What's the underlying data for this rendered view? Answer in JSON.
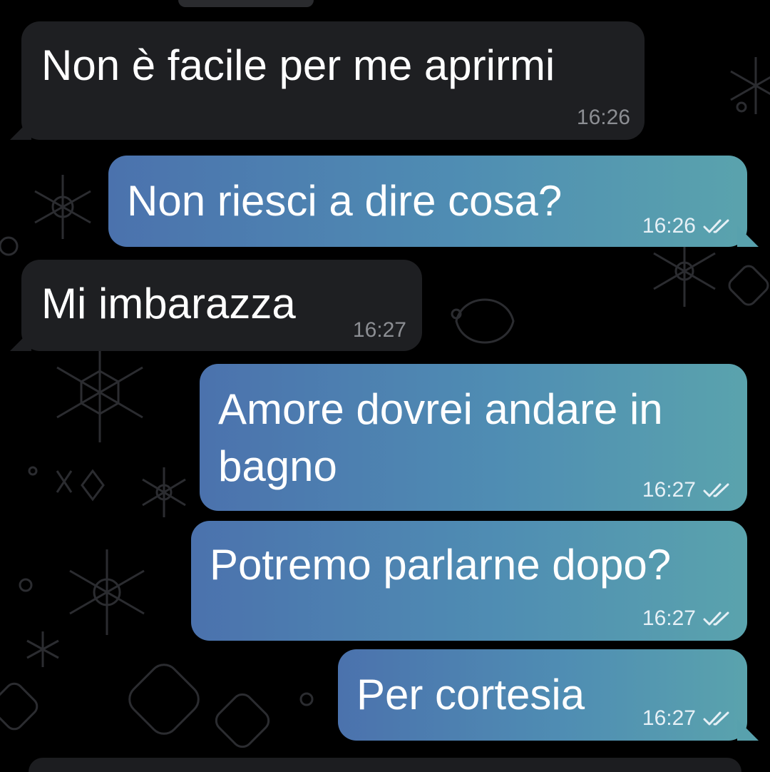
{
  "messages": [
    {
      "text": "Non è facile per me aprirmi",
      "time": "16:26",
      "direction": "incoming"
    },
    {
      "text": "Non riesci a dire cosa?",
      "time": "16:26",
      "direction": "outgoing",
      "status": "read"
    },
    {
      "text": "Mi imbarazza",
      "time": "16:27",
      "direction": "incoming"
    },
    {
      "text": "Amore dovrei andare in bagno",
      "time": "16:27",
      "direction": "outgoing",
      "status": "read"
    },
    {
      "text": "Potremo parlarne dopo?",
      "time": "16:27",
      "direction": "outgoing",
      "status": "read"
    },
    {
      "text": "Per cortesia",
      "time": "16:27",
      "direction": "outgoing",
      "status": "read"
    }
  ],
  "icons": {
    "read_receipt": "double-check-icon",
    "background": "snowflake-doodle-pattern"
  },
  "colors": {
    "background": "#000000",
    "incoming_bubble": "#1e1f22",
    "outgoing_gradient_start": "#4b72ad",
    "outgoing_gradient_end": "#5aa3ad",
    "text": "#ffffff",
    "incoming_time": "#8c8e93"
  }
}
